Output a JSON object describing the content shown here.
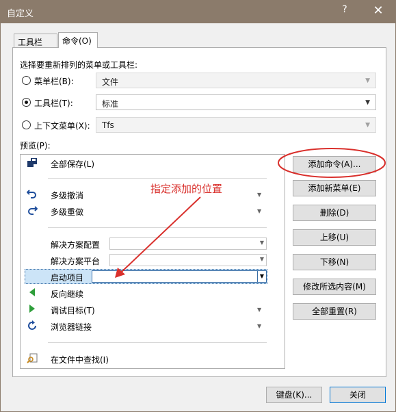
{
  "window": {
    "title": "自定义",
    "help_glyph": "?",
    "close_glyph": "✕"
  },
  "tabs": [
    {
      "label": "工具栏(S)",
      "active": false
    },
    {
      "label": "命令(O)",
      "active": true
    }
  ],
  "section_label": "选择要重新排列的菜单或工具栏:",
  "rearrange": {
    "menubar": {
      "label": "菜单栏(B):",
      "value": "文件",
      "checked": false
    },
    "toolbar": {
      "label": "工具栏(T):",
      "value": "标准",
      "checked": true
    },
    "context_menu": {
      "label": "上下文菜单(X):",
      "value": "Tfs",
      "checked": false
    }
  },
  "preview_label": "预览(P):",
  "preview_items": {
    "save_all": "全部保存(L)",
    "undo": "多级撤消",
    "redo": "多级重做",
    "solution_config": "解决方案配置",
    "solution_platform": "解决方案平台",
    "startup_project": "启动项目",
    "step_back": "反向继续",
    "debug_target": "调试目标(T)",
    "browser_link": "浏览器链接",
    "find_in_files": "在文件中查找(I)"
  },
  "buttons": {
    "add_command": "添加命令(A)...",
    "add_new_menu": "添加新菜单(E)",
    "delete": "删除(D)",
    "move_up": "上移(U)",
    "move_down": "下移(N)",
    "modify_selection": "修改所选内容(M)",
    "reset_all": "全部重置(R)",
    "keyboard": "键盘(K)...",
    "close": "关闭"
  },
  "annotation": "指定添加的位置",
  "colors": {
    "title_bar": "#8b7b6b",
    "accent": "#0078d7",
    "annotation": "#d9302c",
    "play_green": "#2e9e3a"
  }
}
